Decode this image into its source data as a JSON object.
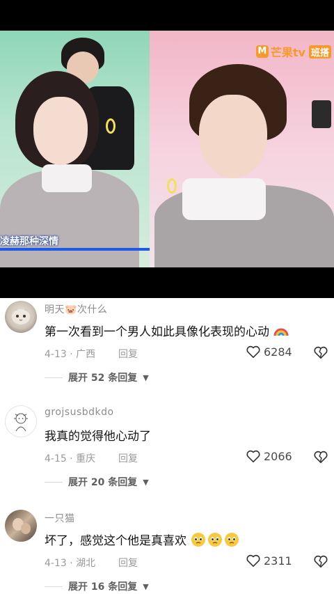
{
  "video": {
    "logo_text": "芒果tv",
    "logo_badge": "班搭",
    "caption": "凌赫那种深情",
    "progress": 1.0
  },
  "comments": [
    {
      "username": "明天🐷次什么",
      "avatar_icon": "cat-avatar",
      "text": "第一次看到一个男人如此具像化表现的心动",
      "trailing_emoji": "rainbow-emoji",
      "date_location": "4-13 · 广西",
      "reply_label": "回复",
      "likes": "6284",
      "expand_label": "展开 52 条回复"
    },
    {
      "username": "grojsusbdkdo",
      "avatar_icon": "sketch-avatar",
      "text": "我真的觉得他心动了",
      "trailing_emoji": "",
      "date_location": "4-15 · 重庆",
      "reply_label": "回复",
      "likes": "2066",
      "expand_label": "展开 20 条回复"
    },
    {
      "username": "一只猫",
      "avatar_icon": "photo-avatar",
      "text": "坏了，感觉这个他是真喜欢",
      "trailing_emoji": "pleading-face-emoji x3",
      "date_location": "4-13 · 湖北",
      "reply_label": "回复",
      "likes": "2311",
      "expand_label": "展开 16 条回复"
    }
  ]
}
